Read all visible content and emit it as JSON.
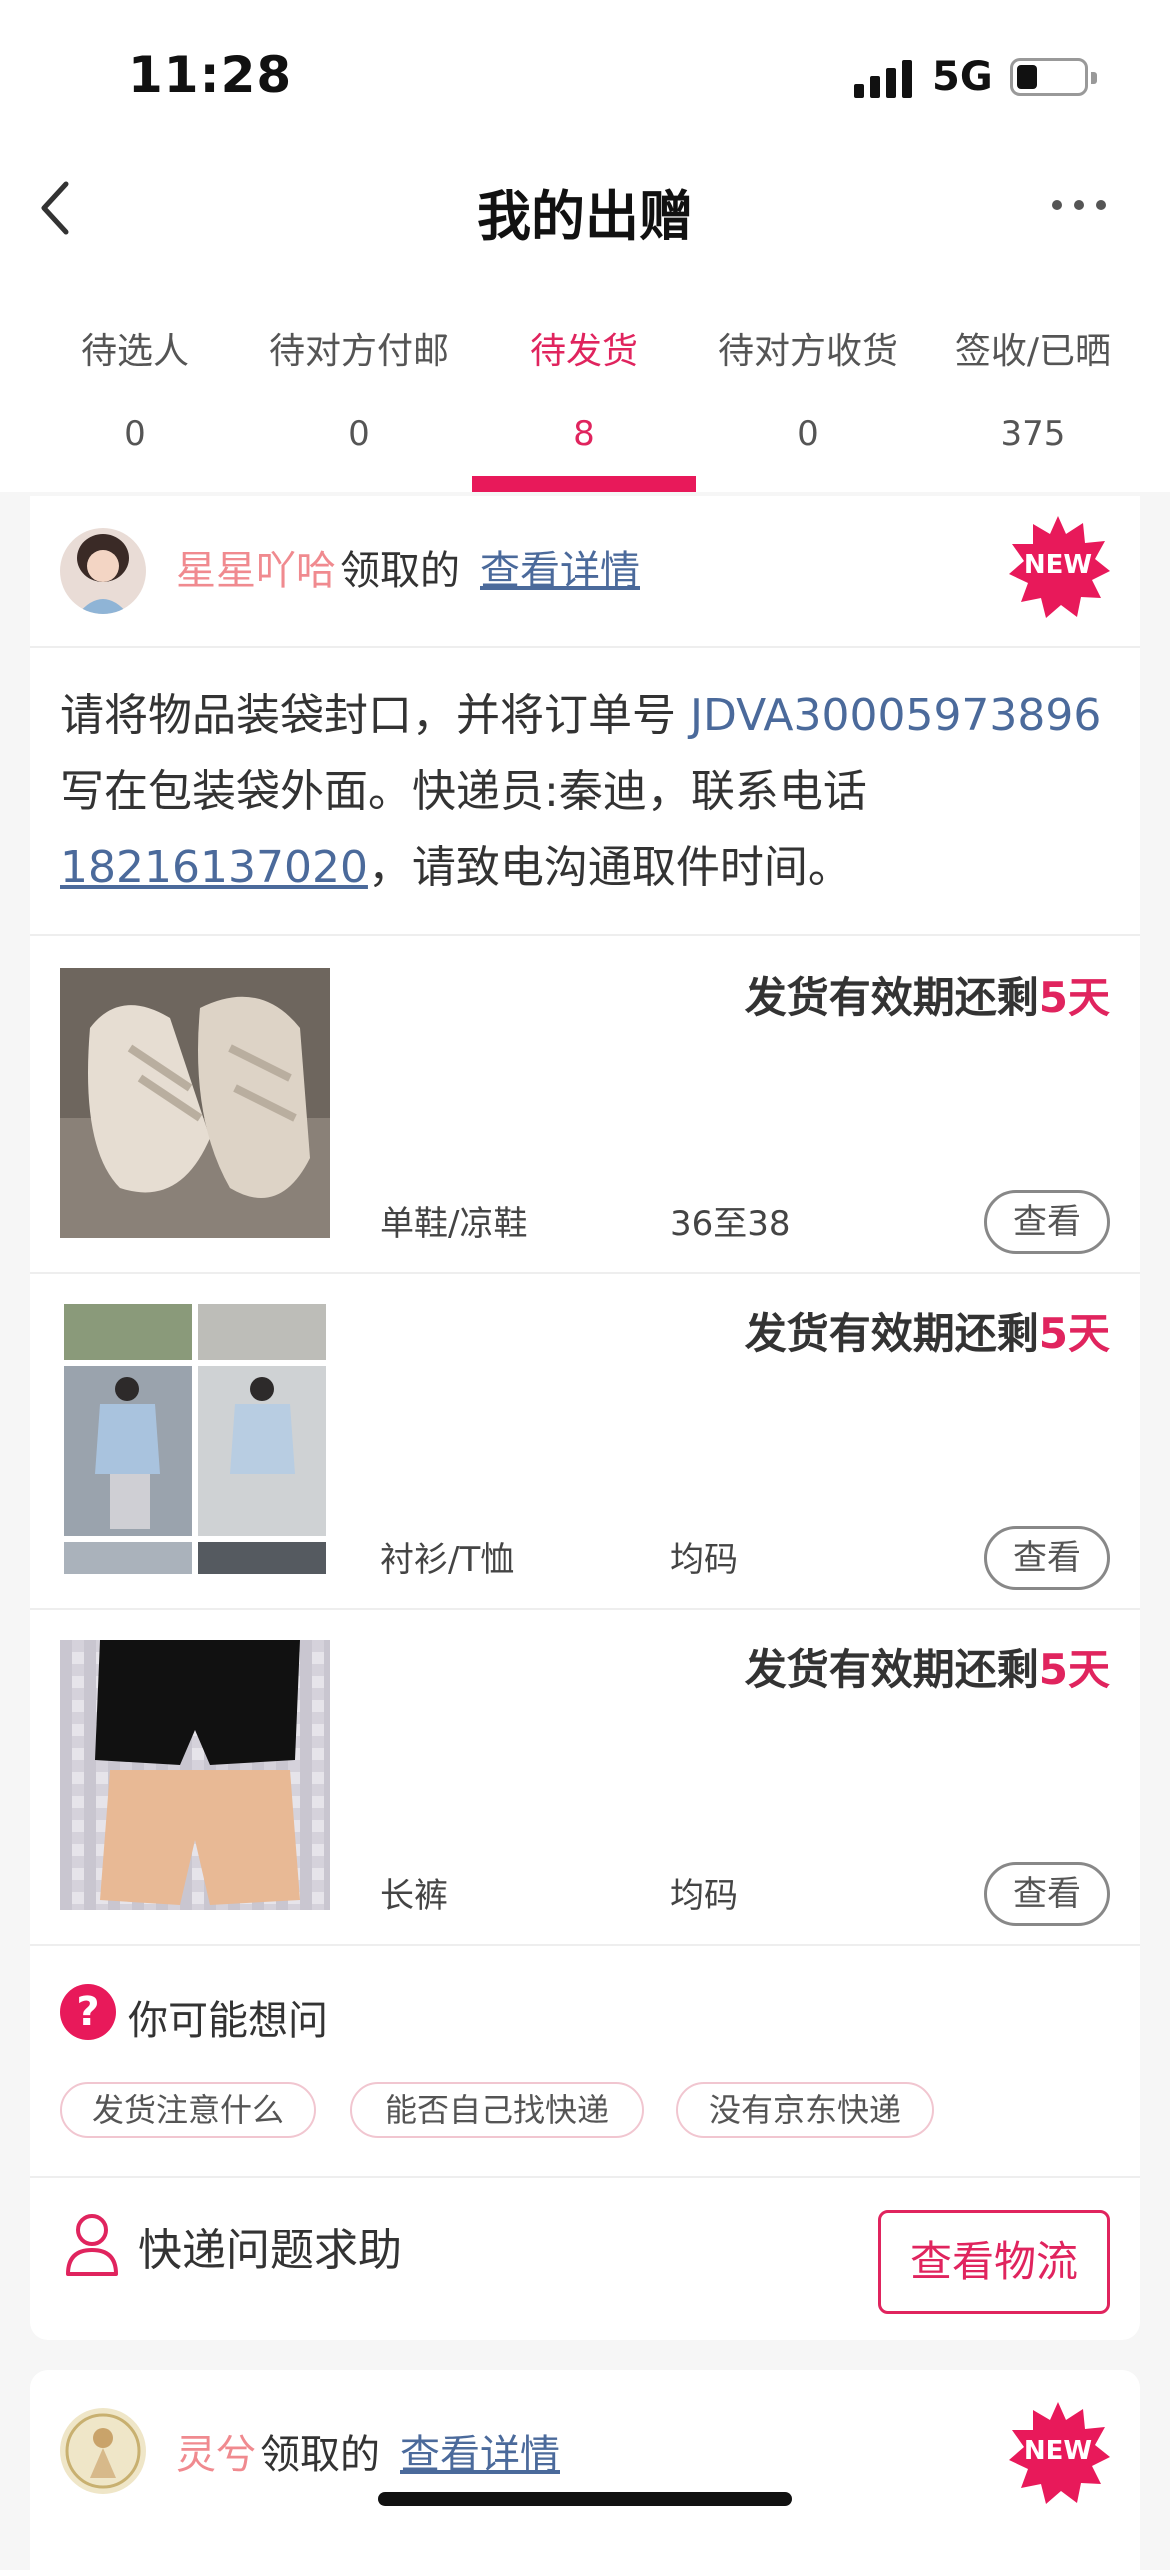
{
  "status_bar": {
    "time": "11:28",
    "network": "5G"
  },
  "nav": {
    "title": "我的出赠"
  },
  "tabs": [
    {
      "label": "待选人",
      "count": "0"
    },
    {
      "label": "待对方付邮",
      "count": "0"
    },
    {
      "label": "待发货",
      "count": "8"
    },
    {
      "label": "待对方收货",
      "count": "0"
    },
    {
      "label": "签收/已晒",
      "count": "375"
    }
  ],
  "active_tab_index": 2,
  "orders": [
    {
      "user": "星星吖哈",
      "claim_text": "领取的",
      "detail_link": "查看详情",
      "badge": "NEW",
      "notice": {
        "part1": "请将物品装袋封口，并将订单号 ",
        "order_no": "JDVA30005973896",
        "part2": " 写在包装袋外面。快递员:秦迪，联系电话",
        "phone": "18216137020",
        "part3": "，请致电沟通取件时间。"
      },
      "items": [
        {
          "deadline_prefix": "发货有效期还剩",
          "deadline_days": "5天",
          "category": "单鞋/凉鞋",
          "size": "36至38",
          "button": "查看"
        },
        {
          "deadline_prefix": "发货有效期还剩",
          "deadline_days": "5天",
          "category": "衬衫/T恤",
          "size": "均码",
          "button": "查看"
        },
        {
          "deadline_prefix": "发货有效期还剩",
          "deadline_days": "5天",
          "category": "长裤",
          "size": "均码",
          "button": "查看"
        }
      ],
      "faq": {
        "title": "你可能想问",
        "chips": [
          "发货注意什么",
          "能否自己找快递",
          "没有京东快递"
        ]
      },
      "help": {
        "label": "快递问题求助",
        "button": "查看物流"
      }
    },
    {
      "user": "灵兮",
      "claim_text": "领取的",
      "detail_link": "查看详情",
      "badge": "NEW"
    }
  ],
  "colors": {
    "accent": "#e0245e",
    "link": "#4b6a9b",
    "username": "#f08a8f"
  }
}
